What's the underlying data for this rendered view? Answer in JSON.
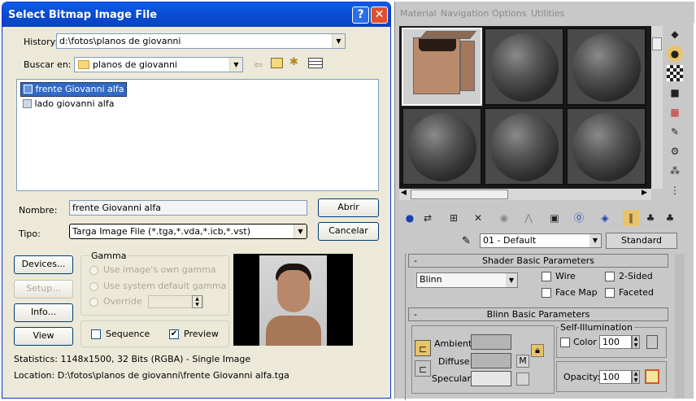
{
  "dialog": {
    "title": "Select Bitmap Image File",
    "help_glyph": "?",
    "close_glyph": "✕",
    "history_label": "History:",
    "history_value": "d:\\fotos\\planos de giovanni",
    "lookin_label": "Buscar en:",
    "lookin_value": "planos de giovanni",
    "files": [
      "frente Giovanni alfa",
      "lado giovanni alfa"
    ],
    "name_label": "Nombre:",
    "name_value": "frente Giovanni alfa",
    "type_label": "Tipo:",
    "type_value": "Targa Image File (*.tga,*.vda,*.icb,*.vst)",
    "open_button": "Abrir",
    "cancel_button": "Cancelar",
    "devices_button": "Devices...",
    "setup_button": "Setup...",
    "info_button": "Info...",
    "view_button": "View",
    "gamma": {
      "title": "Gamma",
      "own": "Use image's own gamma",
      "system": "Use system default gamma",
      "override": "Override"
    },
    "sequence_label": "Sequence",
    "preview_label": "Preview",
    "preview_checked": true,
    "sequence_checked": false,
    "statistics": "Statistics:  1148x1500, 32 Bits (RGBA) - Single Image",
    "location": "Location:  D:\\fotos\\planos de giovanni\\frente Giovanni alfa.tga"
  },
  "editor": {
    "menu": [
      "Material",
      "Navigation",
      "Options",
      "Utilities"
    ],
    "material_name": "01 - Default",
    "material_type": "Standard",
    "shader_rollout": {
      "title": "Shader Basic Parameters",
      "shader": "Blinn",
      "wire": "Wire",
      "two_sided": "2-Sided",
      "face_map": "Face Map",
      "faceted": "Faceted"
    },
    "blinn_rollout": {
      "title": "Blinn Basic Parameters",
      "self_illum": "Self-Illumination",
      "ambient": "Ambient:",
      "diffuse": "Diffuse:",
      "specular": "Specular:",
      "color_label": "Color",
      "color_value": "100",
      "opacity_label": "Opacity:",
      "opacity_value": "100",
      "map_button": "M"
    },
    "collapse_glyph": "-"
  }
}
